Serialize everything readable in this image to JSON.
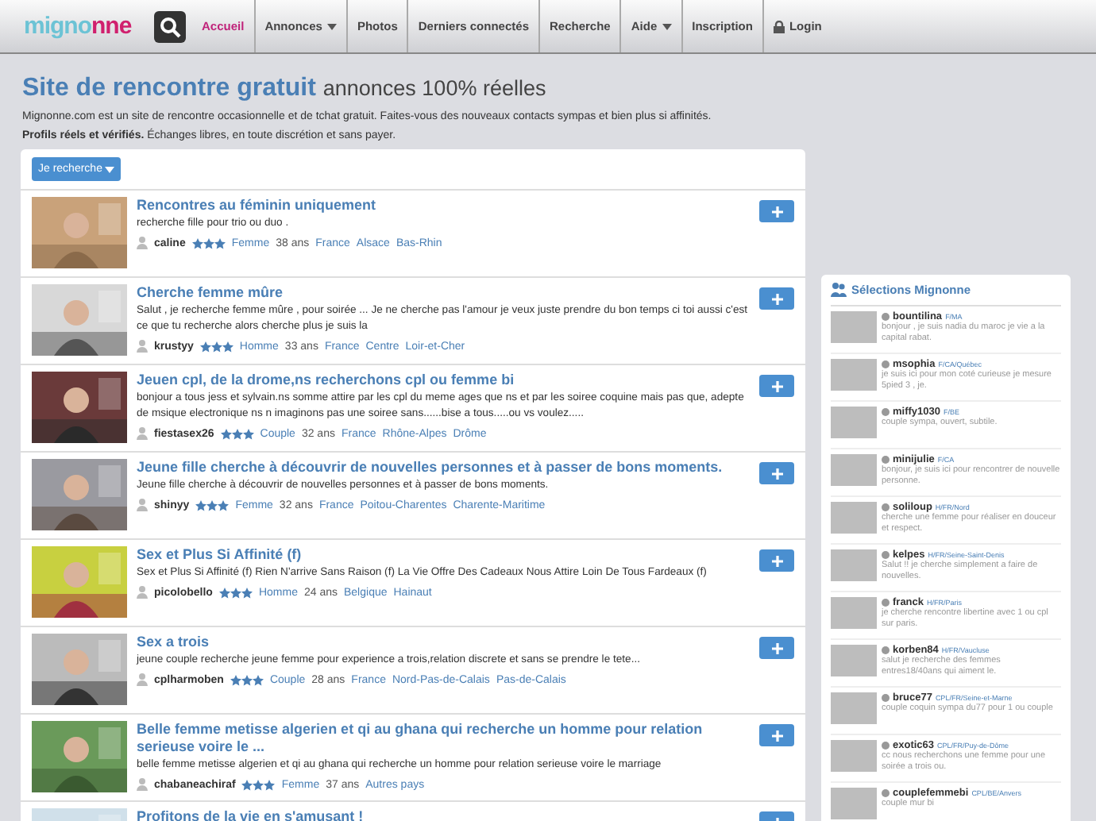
{
  "nav": {
    "logo": {
      "main": "migno",
      "accent": "nne"
    },
    "items": [
      {
        "label": "Accueil",
        "selected": true,
        "kind": "link"
      },
      {
        "label": "Annonces",
        "selected": false,
        "kind": "dropdown"
      },
      {
        "label": "Photos",
        "selected": false,
        "kind": "link"
      },
      {
        "label": "Derniers connectés",
        "selected": false,
        "kind": "link"
      },
      {
        "label": "Recherche",
        "selected": false,
        "kind": "link"
      },
      {
        "label": "Aide",
        "selected": false,
        "kind": "dropdown"
      },
      {
        "label": "Inscription",
        "selected": false,
        "kind": "link"
      },
      {
        "label": "Login",
        "selected": false,
        "kind": "login"
      }
    ]
  },
  "header": {
    "title": "Site de rencontre gratuit",
    "subtitle": "annonces 100% réelles",
    "intro": "Mignonne.com est un site de rencontre occasionnelle et de tchat gratuit. Faites-vous des nouveaux contacts sympas et bien plus si affinités.",
    "intro2": "**Profils réels et vérifiés.** Échanges libres, en toute discrétion et sans payer."
  },
  "filter_button": "Je recherche",
  "listings": [
    {
      "title": "Rencontres au féminin uniquement",
      "text": "recherche fille pour trio ou duo .",
      "user": "caline",
      "stars": 3,
      "gender": "Femme",
      "age": "38 ans",
      "places": [
        "France",
        "Alsace",
        "Bas-Rhin"
      ]
    },
    {
      "title": "Cherche femme mûre",
      "text": "Salut , je recherche femme mûre , pour soirée ... Je ne cherche pas l'amour je veux juste prendre du bon temps ci toi aussi c'est ce que tu recherche alors cherche plus je suis la",
      "user": "krustyy",
      "stars": 3,
      "gender": "Homme",
      "age": "33 ans",
      "places": [
        "France",
        "Centre",
        "Loir-et-Cher"
      ]
    },
    {
      "title": "Jeuen cpl, de la drome,ns recherchons cpl ou femme bi",
      "text": "bonjour a tous jess et sylvain.ns somme attire par les cpl du meme ages que ns et par les soiree coquine mais pas que, adepte de msique electronique ns n imaginons pas une soiree sans......bise a tous.....ou vs voulez.....",
      "user": "fiestasex26",
      "stars": 3,
      "gender": "Couple",
      "age": "32 ans",
      "places": [
        "France",
        "Rhône-Alpes",
        "Drôme"
      ]
    },
    {
      "title": "Jeune fille cherche à découvrir de nouvelles personnes et à passer de bons moments.",
      "text": "Jeune fille cherche à découvrir de nouvelles personnes et à passer de bons moments.",
      "user": "shinyy",
      "stars": 3,
      "gender": "Femme",
      "age": "32 ans",
      "places": [
        "France",
        "Poitou-Charentes",
        "Charente-Maritime"
      ]
    },
    {
      "title": "Sex et Plus Si Affinité (f)",
      "text": "Sex et Plus Si Affinité (f) Rien N'arrive Sans Raison (f) La Vie Offre Des Cadeaux Nous Attire Loin De Tous Fardeaux (f)",
      "user": "picolobello",
      "stars": 3,
      "gender": "Homme",
      "age": "24 ans",
      "places": [
        "Belgique",
        "Hainaut"
      ]
    },
    {
      "title": "Sex a trois",
      "text": "jeune couple recherche jeune femme pour experience a trois,relation discrete et sans se prendre le tete...",
      "user": "cplharmoben",
      "stars": 3,
      "gender": "Couple",
      "age": "28 ans",
      "places": [
        "France",
        "Nord-Pas-de-Calais",
        "Pas-de-Calais"
      ]
    },
    {
      "title": "Belle femme metisse algerien et qi au ghana qui recherche un homme pour relation serieuse voire le ...",
      "text": "belle femme metisse algerien et qi au ghana qui recherche un homme pour relation serieuse voire le marriage",
      "user": "chabaneachiraf",
      "stars": 3,
      "gender": "Femme",
      "age": "37 ans",
      "places": [
        "Autres pays"
      ]
    },
    {
      "title": "Profitons de la vie en s'amusant !"
    }
  ],
  "sidebar": {
    "title": "Sélections Mignonne",
    "items": [
      {
        "name": "bountilina",
        "tag": "F/MA",
        "text": "bonjour , je suis nadia du maroc je vie a la capital rabat."
      },
      {
        "name": "msophia",
        "tag": "F/CA/Québec",
        "text": "je suis ici pour mon coté curieuse je mesure 5pied 3 , je."
      },
      {
        "name": "miffy1030",
        "tag": "F/BE",
        "text": "couple sympa, ouvert, subtile."
      },
      {
        "name": "minijulie",
        "tag": "F/CA",
        "text": "bonjour, je suis ici pour rencontrer de nouvelle personne."
      },
      {
        "name": "soliloup",
        "tag": "H/FR/Nord",
        "text": "cherche une femme pour réaliser en douceur et respect."
      },
      {
        "name": "kelpes",
        "tag": "H/FR/Seine-Saint-Denis",
        "text": "Salut !! je cherche simplement a faire de nouvelles."
      },
      {
        "name": "franck",
        "tag": "H/FR/Paris",
        "text": "je cherche rencontre libertine avec 1 ou cpl sur paris."
      },
      {
        "name": "korben84",
        "tag": "H/FR/Vaucluse",
        "text": "salut je recherche des femmes entres18/40ans qui aiment le."
      },
      {
        "name": "bruce77",
        "tag": "CPL/FR/Seine-et-Marne",
        "text": "couple coquin sympa du77 pour 1 ou couple"
      },
      {
        "name": "exotic63",
        "tag": "CPL/FR/Puy-de-Dôme",
        "text": "cc nous recherchons une femme pour une soirée a trois ou."
      },
      {
        "name": "couplefemmebi",
        "tag": "CPL/BE/Anvers",
        "text": "couple mur bi"
      }
    ]
  }
}
